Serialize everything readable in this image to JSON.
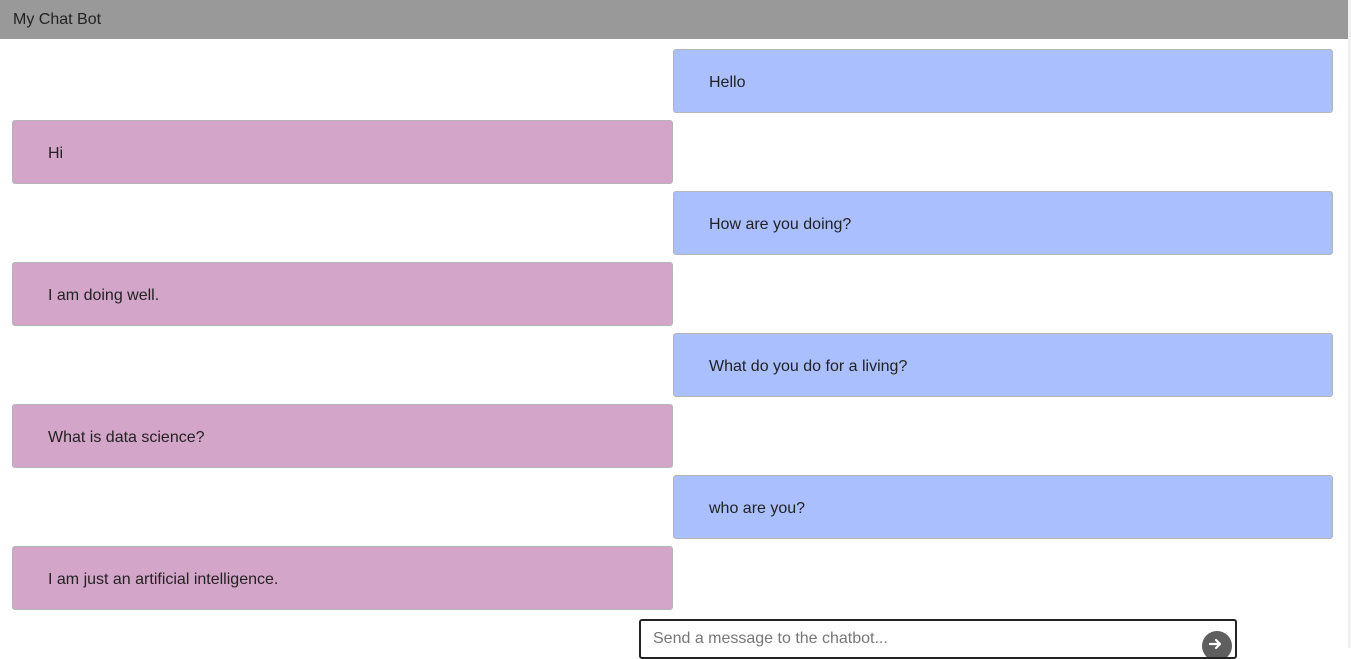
{
  "app": {
    "title": "My Chat Bot"
  },
  "colors": {
    "user_bubble": "#aabffe",
    "bot_bubble": "#d3a5c9",
    "header": "#999999"
  },
  "messages": [
    {
      "sender": "user",
      "text": "Hello"
    },
    {
      "sender": "bot",
      "text": "Hi"
    },
    {
      "sender": "user",
      "text": "How are you doing?"
    },
    {
      "sender": "bot",
      "text": "I am doing well."
    },
    {
      "sender": "user",
      "text": "What do you do for a living?"
    },
    {
      "sender": "bot",
      "text": "What is data science?"
    },
    {
      "sender": "user",
      "text": "who are you?"
    },
    {
      "sender": "bot",
      "text": "I am just an artificial intelligence."
    }
  ],
  "composer": {
    "placeholder": "Send a message to the chatbot...",
    "value": "",
    "send_icon": "send-arrow-icon"
  }
}
